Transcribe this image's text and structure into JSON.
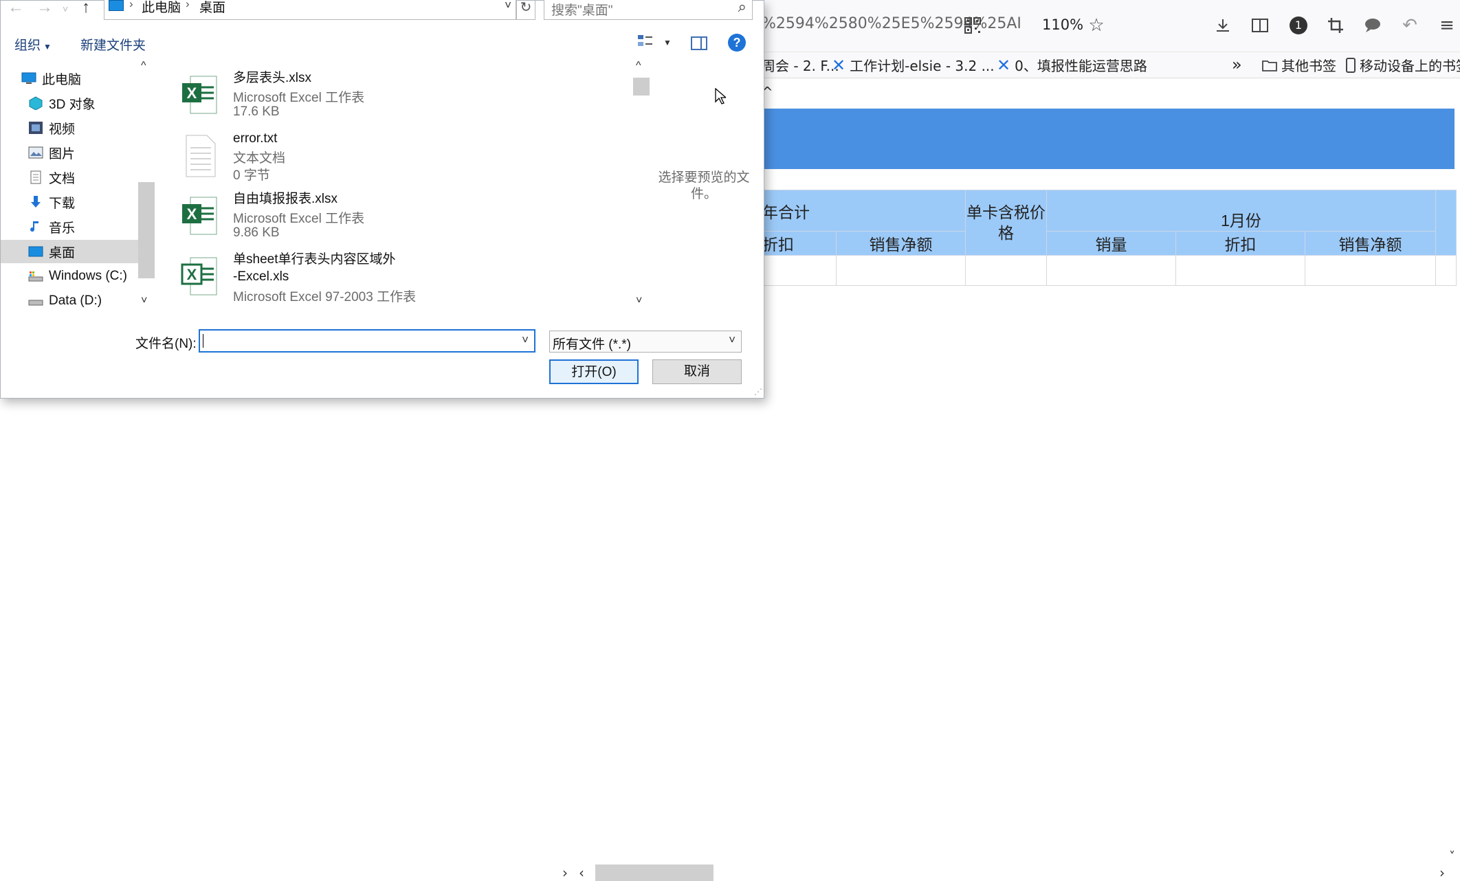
{
  "browser": {
    "url_fragment": "%2594%2580%25E5%2594%25AI",
    "zoom": "110%",
    "badge_count": "1",
    "bookmarks": [
      {
        "label": "周会 - 2. F..."
      },
      {
        "label": "工作计划-elsie - 3.2 ..."
      },
      {
        "label": "0、填报性能运营思路"
      }
    ],
    "other_bookmarks": "其他书签",
    "mobile_bookmarks": "移动设备上的书签",
    "page_caret": "^",
    "table": {
      "header_year_total": "年合计",
      "header_unit_price": "单卡含税价格",
      "header_month": "1月份",
      "sub_discount_1": "折扣",
      "sub_net_sales_1": "销售净额",
      "sub_volume": "销量",
      "sub_discount_2": "折扣",
      "sub_net_sales_2": "销售净额"
    }
  },
  "dialog": {
    "breadcrumb": [
      "此电脑",
      "桌面"
    ],
    "search_placeholder": "搜索\"桌面\"",
    "organize_label": "组织",
    "new_folder_label": "新建文件夹",
    "help_label": "?",
    "nav_tree": [
      {
        "label": "此电脑",
        "icon": "pc-icon"
      },
      {
        "label": "3D 对象",
        "icon": "3d-objects-icon"
      },
      {
        "label": "视频",
        "icon": "video-icon"
      },
      {
        "label": "图片",
        "icon": "pictures-icon"
      },
      {
        "label": "文档",
        "icon": "documents-icon"
      },
      {
        "label": "下载",
        "icon": "download-icon"
      },
      {
        "label": "音乐",
        "icon": "music-icon"
      },
      {
        "label": "桌面",
        "icon": "desktop-icon",
        "selected": true
      },
      {
        "label": "Windows (C:)",
        "icon": "drive-c-icon"
      },
      {
        "label": "Data (D:)",
        "icon": "drive-d-icon"
      }
    ],
    "files": [
      {
        "name": "多层表头.xlsx",
        "type": "Microsoft Excel 工作表",
        "size": "17.6 KB",
        "icon": "excel-icon"
      },
      {
        "name": "error.txt",
        "type": "文本文档",
        "size": "0 字节",
        "icon": "text-file-icon"
      },
      {
        "name": "自由填报报表.xlsx",
        "type": "Microsoft Excel 工作表",
        "size": "9.86 KB",
        "icon": "excel-icon"
      },
      {
        "name": "单sheet单行表头内容区域外",
        "name_line2": "-Excel.xls",
        "type": "Microsoft Excel 97-2003 工作表",
        "icon": "excel-legacy-icon"
      }
    ],
    "preview_text": "选择要预览的文件。",
    "filename_label": "文件名(N):",
    "filename_value": "",
    "filetype_selected": "所有文件 (*.*)",
    "open_button": "打开(O)",
    "cancel_button": "取消"
  },
  "colors": {
    "banner_blue": "#4a90e2",
    "header_light_blue": "#9ccaf8",
    "excel_green": "#1d6f42",
    "accent_blue": "#1e73d6"
  }
}
